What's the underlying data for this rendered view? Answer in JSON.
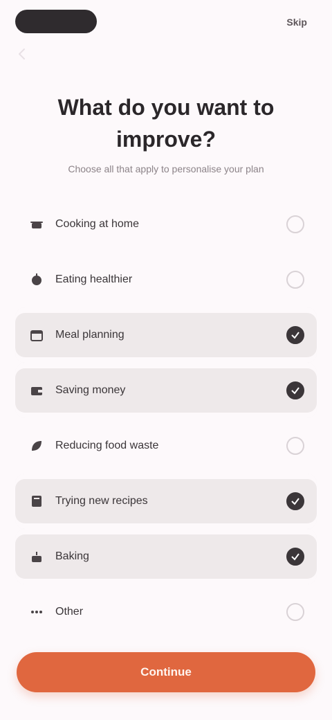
{
  "header": {
    "brand_label": "",
    "skip_label": "Skip"
  },
  "heading": "What do you want to improve?",
  "subheading": "Choose all that apply to personalise your plan",
  "options": [
    {
      "label": "Cooking at home",
      "selected": false,
      "icon": "pot-icon"
    },
    {
      "label": "Eating healthier",
      "selected": false,
      "icon": "apple-icon"
    },
    {
      "label": "Meal planning",
      "selected": true,
      "icon": "calendar-icon"
    },
    {
      "label": "Saving money",
      "selected": true,
      "icon": "wallet-icon"
    },
    {
      "label": "Reducing food waste",
      "selected": false,
      "icon": "leaf-icon"
    },
    {
      "label": "Trying new recipes",
      "selected": true,
      "icon": "book-icon"
    },
    {
      "label": "Baking",
      "selected": true,
      "icon": "cake-icon"
    },
    {
      "label": "Other",
      "selected": false,
      "icon": "dots-icon"
    }
  ],
  "continue_label": "Continue",
  "colors": {
    "accent": "#e0673f",
    "selected_bg": "#eee9ea",
    "dark": "#2f2b2e"
  }
}
